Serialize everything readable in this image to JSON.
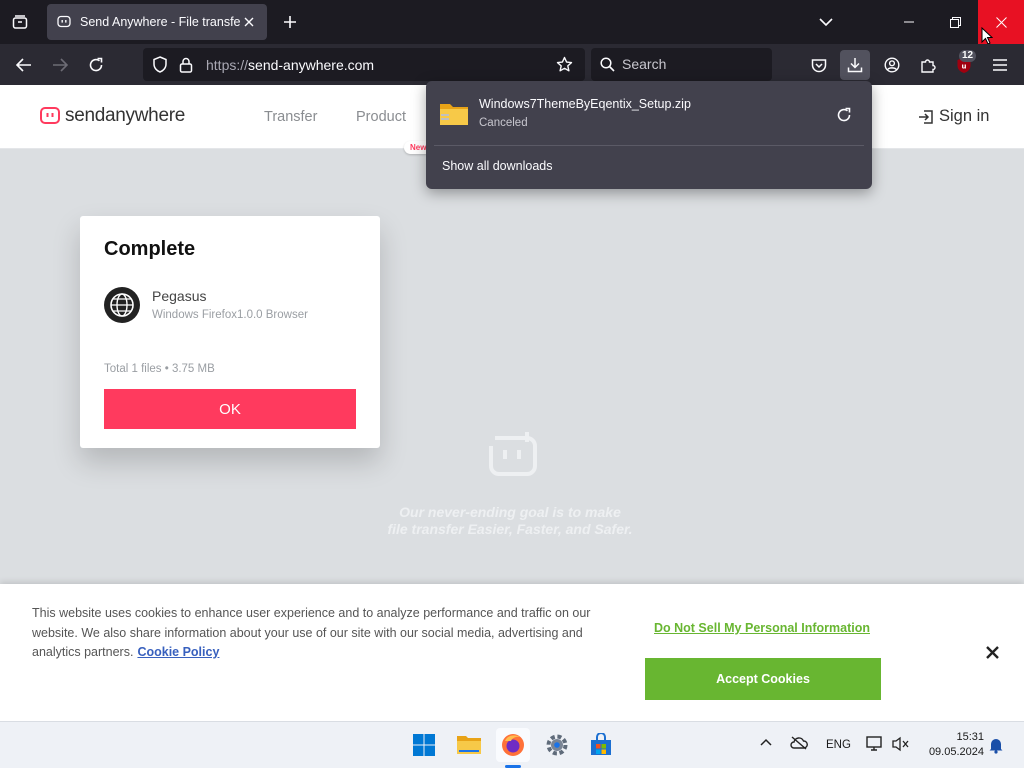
{
  "browser": {
    "tab_title": "Send Anywhere - File transfer",
    "url_protocol": "https://",
    "url_host": "send-anywhere.com",
    "search_placeholder": "Search",
    "extension_badge": "12",
    "accent_color": "#e81123"
  },
  "downloads": {
    "items": [
      {
        "filename": "Windows7ThemeByEqentix_Setup.zip",
        "status": "Canceled"
      }
    ],
    "show_all": "Show all downloads"
  },
  "site": {
    "logo_send": "send",
    "logo_anywhere": "anywhere",
    "nav": [
      "Transfer",
      "Product"
    ],
    "new_pill": "New",
    "signin": "Sign in",
    "brand_color": "#ff3a5e"
  },
  "card": {
    "heading": "Complete",
    "device_name": "Pegasus",
    "device_desc": "Windows Firefox1.0.0 Browser",
    "summary": "Total 1 files • 3.75 MB",
    "ok": "OK"
  },
  "tagline": {
    "line1": "Our never-ending goal is to make",
    "line2": "file transfer Easier, Faster, and Safer."
  },
  "cookie": {
    "text": "This website uses cookies to enhance user experience and to analyze performance and traffic on our website. We also share information about your use of our site with our social media, advertising and analytics partners.",
    "policy_link": "Cookie Policy",
    "do_not_sell": "Do Not Sell My Personal Information",
    "accept": "Accept Cookies",
    "accent_color": "#68b631"
  },
  "taskbar": {
    "language": "ENG",
    "time": "15:31",
    "date": "09.05.2024"
  }
}
